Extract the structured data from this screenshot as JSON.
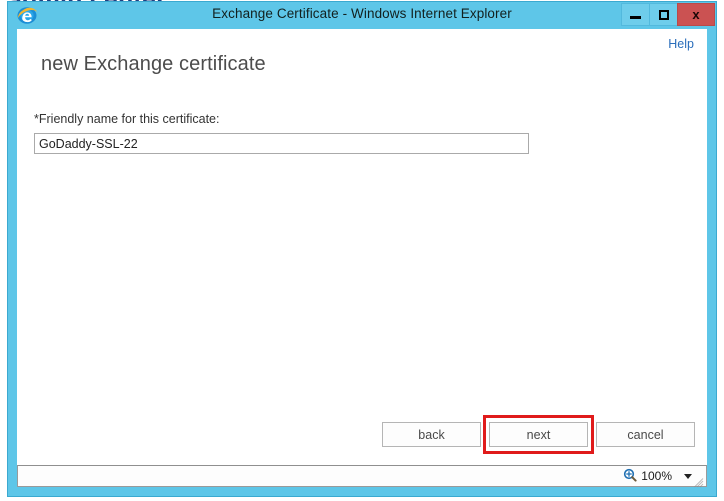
{
  "background": {
    "heading": "admin center"
  },
  "window": {
    "title": "Exchange Certificate - Windows Internet Explorer",
    "app_icon": "internet-explorer-icon",
    "controls": {
      "minimize": "minimize-icon",
      "maximize": "maximize-icon",
      "close_label": "x"
    },
    "colors": {
      "titlebar": "#5ec6e8",
      "close_button": "#cb5252",
      "accent_link": "#2a6ebb",
      "annotation": "#e01b1b"
    }
  },
  "content": {
    "help_label": "Help",
    "page_title": "new Exchange certificate",
    "field": {
      "label": "*Friendly name for this certificate:",
      "value": "GoDaddy-SSL-22",
      "placeholder": ""
    }
  },
  "buttons": {
    "back_label": "back",
    "next_label": "next",
    "cancel_label": "cancel",
    "highlighted": "next"
  },
  "statusbar": {
    "zoom_icon": "magnifier-plus-icon",
    "zoom_level": "100%",
    "dropdown_icon": "chevron-down-icon",
    "resize_grip": "resize-grip-icon"
  }
}
